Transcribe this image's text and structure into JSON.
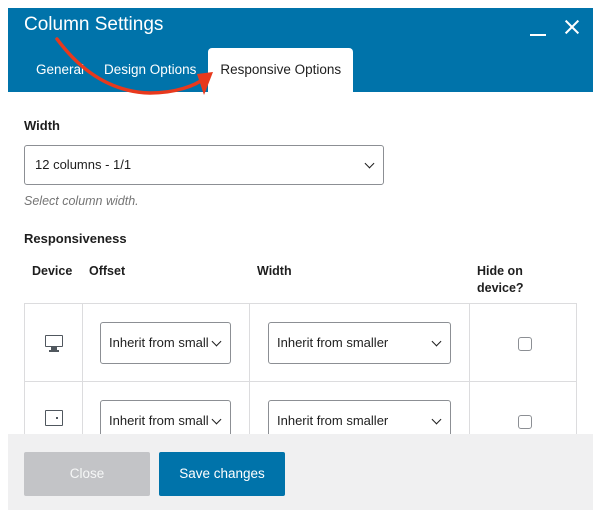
{
  "dialog": {
    "title": "Column Settings"
  },
  "tabs": [
    {
      "label": "General"
    },
    {
      "label": "Design Options"
    },
    {
      "label": "Responsive Options",
      "active": true
    }
  ],
  "width": {
    "label": "Width",
    "selected": "12 columns - 1/1",
    "help": "Select column width."
  },
  "responsiveness": {
    "label": "Responsiveness",
    "headers": {
      "device": "Device",
      "offset": "Offset",
      "width": "Width",
      "hide_line1": "Hide on",
      "hide_line2": "device?"
    },
    "rows": [
      {
        "device_icon": "monitor-icon",
        "offset": "Inherit from small",
        "width": "Inherit from smaller",
        "hide": false
      },
      {
        "device_icon": "tablet-icon",
        "offset": "Inherit from small",
        "width": "Inherit from smaller",
        "hide": false
      }
    ]
  },
  "footer": {
    "close_label": "Close",
    "save_label": "Save changes"
  },
  "colors": {
    "header": "#0073aa",
    "annotation_arrow": "#e8391d",
    "close_button": "#c3c4c7",
    "save_button": "#0073aa"
  }
}
